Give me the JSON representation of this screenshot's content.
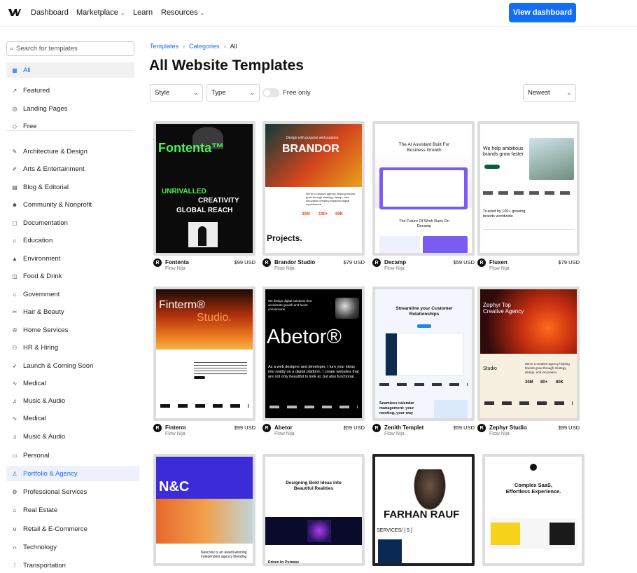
{
  "nav": {
    "dashboard": "Dashboard",
    "marketplace": "Marketplace",
    "learn": "Learn",
    "resources": "Resources",
    "view_dashboard": "View dashboard"
  },
  "search": {
    "placeholder": "Search for templates"
  },
  "sidebar": {
    "items": [
      {
        "label": "All",
        "icon": "grid-icon"
      },
      {
        "label": "Featured",
        "icon": "chart-icon"
      },
      {
        "label": "Landing Pages",
        "icon": "pin-icon"
      },
      {
        "label": "Free",
        "icon": "tag-icon"
      },
      {
        "label": "Architecture & Design",
        "icon": "ruler-icon"
      },
      {
        "label": "Arts & Entertainment",
        "icon": "brush-icon"
      },
      {
        "label": "Blog & Editorial",
        "icon": "page-icon"
      },
      {
        "label": "Community & Nonprofit",
        "icon": "people-icon"
      },
      {
        "label": "Documentation",
        "icon": "doc-icon"
      },
      {
        "label": "Education",
        "icon": "cap-icon"
      },
      {
        "label": "Environment",
        "icon": "mountain-icon"
      },
      {
        "label": "Food & Drink",
        "icon": "cup-icon"
      },
      {
        "label": "Government",
        "icon": "building-icon"
      },
      {
        "label": "Hair & Beauty",
        "icon": "scissors-icon"
      },
      {
        "label": "Home Services",
        "icon": "wrench-icon"
      },
      {
        "label": "HR & Hiring",
        "icon": "users-icon"
      },
      {
        "label": "Launch & Coming Soon",
        "icon": "rocket-icon"
      },
      {
        "label": "Medical",
        "icon": "pulse-icon"
      },
      {
        "label": "Music & Audio",
        "icon": "music-icon"
      },
      {
        "label": "Medical",
        "icon": "pulse-icon"
      },
      {
        "label": "Music & Audio",
        "icon": "music-icon"
      },
      {
        "label": "Personal",
        "icon": "card-icon"
      },
      {
        "label": "Portfolio & Agency",
        "icon": "person-icon"
      },
      {
        "label": "Professional Services",
        "icon": "gear-icon"
      },
      {
        "label": "Real Estate",
        "icon": "house-icon"
      },
      {
        "label": "Retail & E-Commerce",
        "icon": "cart-icon"
      },
      {
        "label": "Technology",
        "icon": "code-icon"
      },
      {
        "label": "Transportation",
        "icon": "grid-dots-icon"
      }
    ]
  },
  "breadcrumb": {
    "templates": "Templates",
    "categories": "Categories",
    "current": "All"
  },
  "title": "All Website Templates",
  "filters": {
    "style": "Style",
    "type": "Type",
    "free_only": "Free only",
    "sort": "Newest"
  },
  "cards": [
    {
      "name": "Fontenta",
      "price": "$99 USD",
      "author": "Flow Nija",
      "t1": "Fontenta™",
      "t2": "UNRIVALLED",
      "t3": "CREATIVITY",
      "t4": "GLOBAL REACH"
    },
    {
      "name": "Brandor Studio",
      "price": "$79 USD",
      "author": "Flow Nija",
      "t1": "BRANDOR",
      "t2": "Design with purpose and purpose",
      "t3": "Projects.",
      "t4": "We're a creative agency helping brands grow through strategy, design, and innovation creating impactful digital experiences.",
      "s1": "30M",
      "s2": "100+",
      "s3": "80K"
    },
    {
      "name": "Decamp",
      "price": "$59 USD",
      "author": "Flow Nija",
      "t1": "The AI Assistant Built For Business Growth",
      "t2": "The Future Of Work Runs On Decamp"
    },
    {
      "name": "Fluxen",
      "price": "$79 USD",
      "author": "Flow Nija",
      "t1": "We help ambitious brands grow faster",
      "t2": "Trusted by 100+ growing brands worldwide"
    },
    {
      "name": "Finterm",
      "price": "$99 USD",
      "author": "Flow Nija",
      "t1": "Finterm®",
      "t2": "Studio."
    },
    {
      "name": "Abetor",
      "price": "$59 USD",
      "author": "Flow Nija",
      "t1": "Abetor®",
      "t2": "We design digital solutions that accelerate growth and boost conversions.",
      "t3": "As a web designer and developer, I turn your ideas into reality on a digital platform. I create websites that are not only beautiful to look at, but also functional."
    },
    {
      "name": "Zenith Templet",
      "price": "$59 USD",
      "author": "Flow Nija",
      "t1": "Streamline your Customer Relationships",
      "t2": "Seamless calendar management: your meeting, your way"
    },
    {
      "name": "Zephyr Studio",
      "price": "$99 USD",
      "author": "Flow Nija",
      "t1": "Zephyr Top Creative Agency",
      "t2": "Studio",
      "t3": "We're a creative agency helping brands grow through strategy, design, and innovation.",
      "s1": "30M",
      "s2": "80+",
      "s3": "80K"
    },
    {
      "name": "",
      "price": "",
      "author": "",
      "t1": "N&C",
      "t2": "Neuronix is an award-winning independent agency blending"
    },
    {
      "name": "",
      "price": "",
      "author": "",
      "t1": "Designing Bold Ideas into Beautiful Realities",
      "t2": "Driven by Purpose"
    },
    {
      "name": "",
      "price": "",
      "author": "",
      "t1": "FARHAN RAUF",
      "t2": "SERVICES/ [ 5 ]"
    },
    {
      "name": "",
      "price": "",
      "author": "",
      "t1": "Complex SaaS, Effortless Experience."
    }
  ]
}
